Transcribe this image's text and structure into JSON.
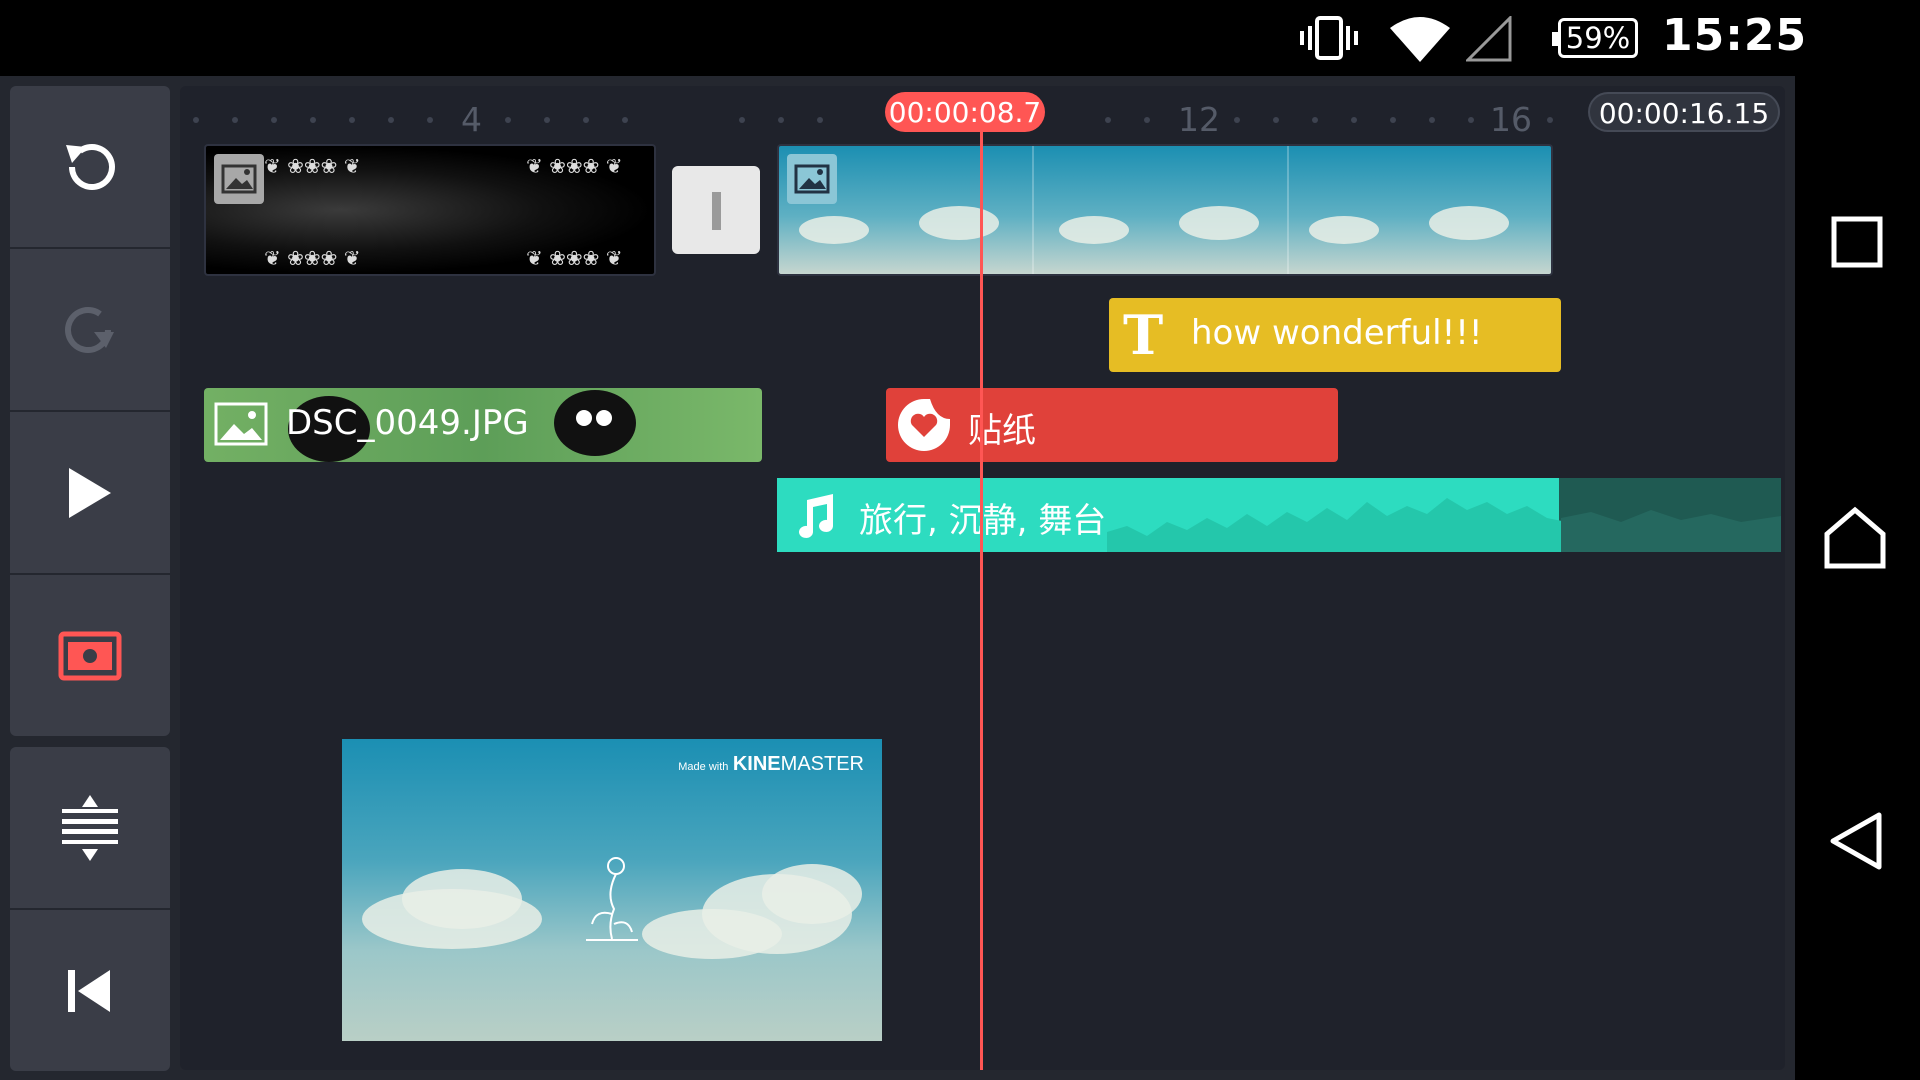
{
  "status_bar": {
    "battery": "59%",
    "time": "15:25",
    "icons": [
      "vibrate-icon",
      "wifi-icon",
      "signal-icon",
      "battery-icon"
    ]
  },
  "timeline": {
    "ruler_labels": [
      "4",
      "12",
      "16"
    ],
    "playhead_time": "00:00:08.7",
    "end_time": "00:00:16.15"
  },
  "clips": {
    "text_clip": "how wonderful!!!",
    "image_clip": "DSC_0049.JPG",
    "sticker_clip": "贴纸",
    "audio_clip": "旅行, 沉静, 舞台"
  },
  "preview": {
    "watermark_prefix": "Made with",
    "watermark_brand": "KINE",
    "watermark_brand2": "MASTER"
  },
  "colors": {
    "accent_red": "#ff5654",
    "text_clip_yellow": "#e6bd24",
    "sticker_red": "#e0413a",
    "audio_teal": "#2ddcc0",
    "image_green": "#6aaa5e"
  }
}
